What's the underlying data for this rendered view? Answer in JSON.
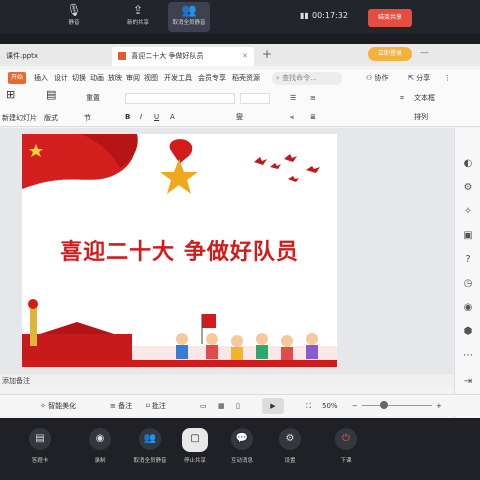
{
  "top_bar": {
    "mute_label": "静音",
    "new_share_label": "新的共享",
    "cancel_mute_label": "取消全员静音",
    "timer": "00:17:32",
    "end_share_label": "结束共享"
  },
  "tabs": [
    {
      "label": "课件.pptx"
    },
    {
      "label": "喜迎二十大 争做好队员"
    }
  ],
  "menu": {
    "start_label": "开始",
    "items": [
      "插入",
      "设计",
      "切换",
      "动画",
      "放映",
      "审阅",
      "视图",
      "开发工具",
      "会员专享",
      "稻壳资源"
    ],
    "search_placeholder": "查找命令...",
    "collab_label": "协作",
    "share_label": "分享",
    "vip_label": "立即登录"
  },
  "toolbar": {
    "new_slide": "新建幻灯片",
    "layout": "版式",
    "section": "节",
    "reset": "重置",
    "text_box": "文本框",
    "arrange": "排列"
  },
  "slide": {
    "title": "喜迎二十大 争做好队员"
  },
  "notes_placeholder": "添加备注",
  "status": {
    "beautify": "智能美化",
    "notes": "备注",
    "comments": "批注",
    "zoom": "50%"
  },
  "bottom_bar": {
    "items": [
      {
        "label": "答题卡"
      },
      {
        "label": "录制"
      },
      {
        "label": "取消全员静音"
      },
      {
        "label": "停止共享"
      },
      {
        "label": "互动消息"
      },
      {
        "label": "设置"
      },
      {
        "label": "下课"
      }
    ]
  },
  "colors": {
    "accent_red": "#d11c1c",
    "end_button": "#e54d42",
    "meeting_bg": "#1f2126"
  }
}
